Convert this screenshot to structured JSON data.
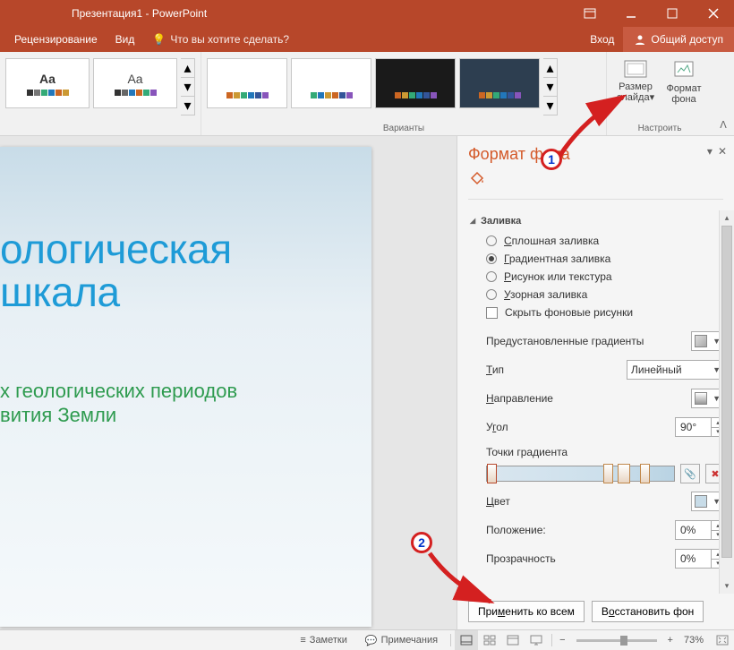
{
  "title_bar": {
    "title": "Презентация1 - PowerPoint"
  },
  "menu": {
    "review": "Рецензирование",
    "view": "Вид",
    "tellme": "Что вы хотите сделать?",
    "signin": "Вход",
    "share": "Общий доступ"
  },
  "ribbon": {
    "variants_label": "Варианты",
    "setup_label": "Настроить",
    "size_btn_l1": "Размер",
    "size_btn_l2": "слайда",
    "format_btn_l1": "Формат",
    "format_btn_l2": "фона"
  },
  "slide": {
    "title_l1": "ологическая",
    "title_l2": "шкала",
    "sub_l1": "х геологических периодов",
    "sub_l2": "вития Земли"
  },
  "pane": {
    "title": "Формат фона",
    "section_fill": "Заливка",
    "fill_solid": "Сплошная заливка",
    "fill_gradient": "Градиентная заливка",
    "fill_picture": "Рисунок или текстура",
    "fill_pattern": "Узорная заливка",
    "hide_bg": "Скрыть фоновые рисунки",
    "preset_grad": "Предустановленные градиенты",
    "type": "Тип",
    "type_value": "Линейный",
    "direction": "Направление",
    "angle": "Угол",
    "angle_value": "90°",
    "stops": "Точки градиента",
    "color": "Цвет",
    "position": "Положение:",
    "position_value": "0%",
    "transparency": "Прозрачность",
    "transparency_value": "0%",
    "apply_all": "Применить ко всем",
    "reset": "Восстановить фон"
  },
  "status": {
    "notes": "Заметки",
    "comments": "Примечания",
    "zoom": "73%"
  },
  "annotation": {
    "n1": "1",
    "n2": "2"
  }
}
